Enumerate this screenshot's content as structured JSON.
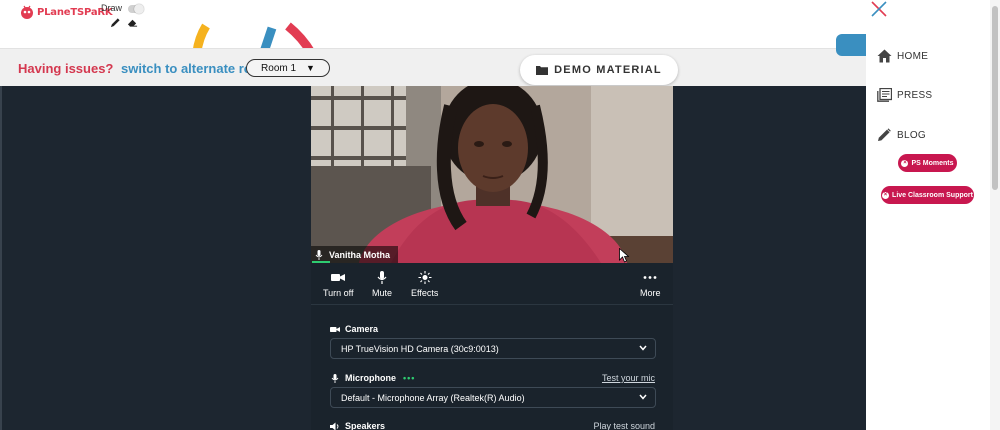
{
  "header": {
    "logo_part1": "PLaneT",
    "logo_part2": "SPaRK",
    "draw_label": "Draw",
    "draw_enabled": false
  },
  "issues_bar": {
    "question": "Having issues?",
    "link": "switch to alternate room",
    "room_selected": "Room 1",
    "caret": "▼"
  },
  "demo_material": {
    "label": "DEMO MATERIAL"
  },
  "video": {
    "participant_name": "Vanitha Motha",
    "mic_level_percent": 5
  },
  "controls": {
    "turn_off": "Turn off",
    "mute": "Mute",
    "effects": "Effects",
    "more": "More"
  },
  "settings": {
    "camera_label": "Camera",
    "camera_value": "HP TrueVision HD Camera (30c9:0013)",
    "microphone_label": "Microphone",
    "microphone_indicator": "•••",
    "test_mic": "Test your mic",
    "microphone_value": "Default - Microphone Array (Realtek(R) Audio)",
    "speakers_label": "Speakers",
    "play_test_sound": "Play test sound"
  },
  "sidenav": {
    "home": "HOME",
    "press": "PRESS",
    "blog": "BLOG",
    "ps_moments": "PS Moments",
    "live_support": "Live Classroom Support"
  },
  "colors": {
    "brand_red": "#c8174f",
    "link_blue": "#3a8fc0",
    "stage_dark": "#1d2630",
    "panel_dark": "#1a232c",
    "mic_green": "#2ecc71"
  }
}
